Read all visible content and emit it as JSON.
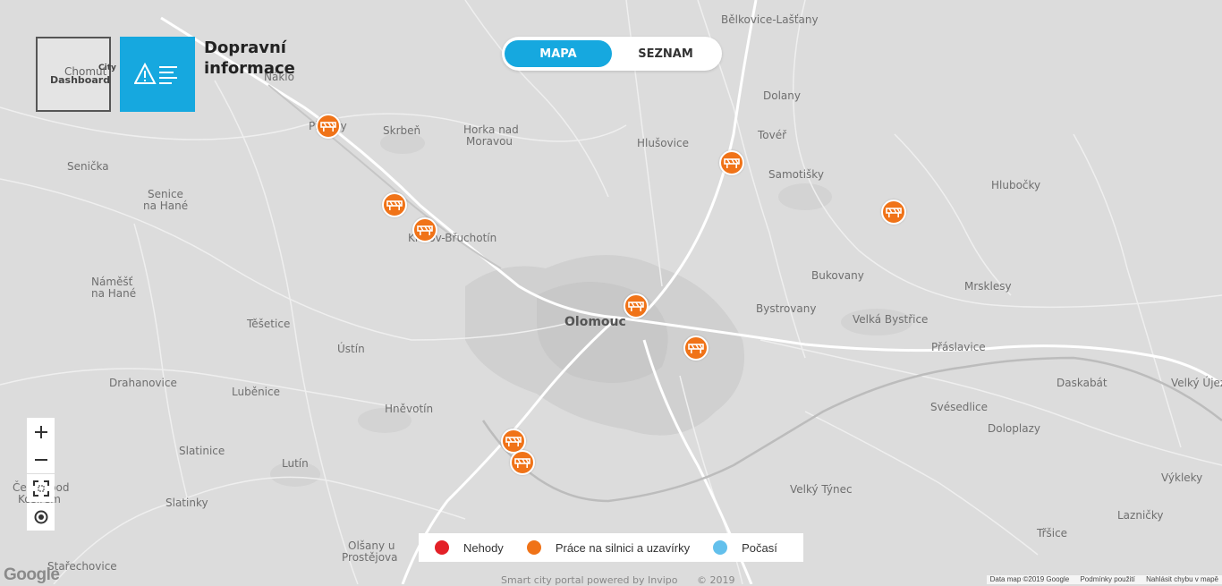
{
  "app": {
    "logo_city": "City",
    "logo_chomutov": "Chomut",
    "logo_dashboard": "Dashboard",
    "title_line1": "Dopravní",
    "title_line2": "informace"
  },
  "view_toggle": {
    "map_label": "MAPA",
    "list_label": "SEZNAM",
    "active": "MAPA"
  },
  "map_places": [
    {
      "name": "Bělkovice-Lašťany",
      "type": "town"
    },
    {
      "name": "Náklo",
      "type": "town"
    },
    {
      "name": "Příkazy",
      "type": "town"
    },
    {
      "name": "Skrbeň",
      "type": "town"
    },
    {
      "name": "Horka nad",
      "type": "town"
    },
    {
      "name": "Moravou",
      "type": "town"
    },
    {
      "name": "Hlušovice",
      "type": "town"
    },
    {
      "name": "Dolany",
      "type": "town"
    },
    {
      "name": "Tovéř",
      "type": "town"
    },
    {
      "name": "Samotišky",
      "type": "town"
    },
    {
      "name": "Hlubočky",
      "type": "town"
    },
    {
      "name": "Senička",
      "type": "town"
    },
    {
      "name": "Senice",
      "type": "town"
    },
    {
      "name": "na Hané",
      "type": "town"
    },
    {
      "name": "Křelov-Břuchotín",
      "type": "town"
    },
    {
      "name": "Bukovany",
      "type": "town"
    },
    {
      "name": "Mrsklesy",
      "type": "town"
    },
    {
      "name": "Náměšť",
      "type": "town"
    },
    {
      "name": "na Hané",
      "type": "town"
    },
    {
      "name": "Olomouc",
      "type": "city"
    },
    {
      "name": "Bystrovany",
      "type": "town"
    },
    {
      "name": "Velká Bystřice",
      "type": "town"
    },
    {
      "name": "Těšetice",
      "type": "town"
    },
    {
      "name": "Ústín",
      "type": "town"
    },
    {
      "name": "Přáslavice",
      "type": "town"
    },
    {
      "name": "Drahanovice",
      "type": "town"
    },
    {
      "name": "Luběnice",
      "type": "town"
    },
    {
      "name": "Hněvotín",
      "type": "town"
    },
    {
      "name": "Daskabát",
      "type": "town"
    },
    {
      "name": "Velký Újezd",
      "type": "town"
    },
    {
      "name": "Svésedlice",
      "type": "town"
    },
    {
      "name": "Doloplazy",
      "type": "town"
    },
    {
      "name": "Slatinice",
      "type": "town"
    },
    {
      "name": "Lutín",
      "type": "town"
    },
    {
      "name": "Velký Týnec",
      "type": "town"
    },
    {
      "name": "Výkleky",
      "type": "town"
    },
    {
      "name": "Čechy pod",
      "type": "town"
    },
    {
      "name": "Kosířem",
      "type": "town"
    },
    {
      "name": "Slatinky",
      "type": "town"
    },
    {
      "name": "Lazničky",
      "type": "town"
    },
    {
      "name": "Olšany u",
      "type": "town"
    },
    {
      "name": "Prostějova",
      "type": "town"
    },
    {
      "name": "Třšice",
      "type": "town"
    },
    {
      "name": "Stařechovice",
      "type": "town"
    }
  ],
  "markers": [
    {
      "category": "Práce na silnici a uzavírky"
    },
    {
      "category": "Práce na silnici a uzavírky"
    },
    {
      "category": "Práce na silnici a uzavírky"
    },
    {
      "category": "Práce na silnici a uzavírky"
    },
    {
      "category": "Práce na silnici a uzavírky"
    },
    {
      "category": "Práce na silnici a uzavírky"
    },
    {
      "category": "Práce na silnici a uzavírky"
    },
    {
      "category": "Práce na silnici a uzavírky"
    },
    {
      "category": "Práce na silnici a uzavírky"
    }
  ],
  "map_controls": {
    "zoom_in": "+",
    "zoom_out": "−"
  },
  "legend": {
    "items": [
      {
        "label": "Nehody",
        "color": "#e32027"
      },
      {
        "label": "Práce na silnici a uzavírky",
        "color": "#f07318"
      },
      {
        "label": "Počasí",
        "color": "#63c0ec"
      }
    ]
  },
  "footer": {
    "text": "Smart city portal powered by Invipo",
    "year": "© 2019"
  },
  "attribution": {
    "data": "Data map ©2019 Google",
    "terms": "Podmínky použití",
    "report": "Nahlásit chybu v mapě",
    "google": "Google"
  },
  "colors": {
    "accent": "#16a8df",
    "marker": "#f07318",
    "map_bg": "#dcdcdc"
  }
}
